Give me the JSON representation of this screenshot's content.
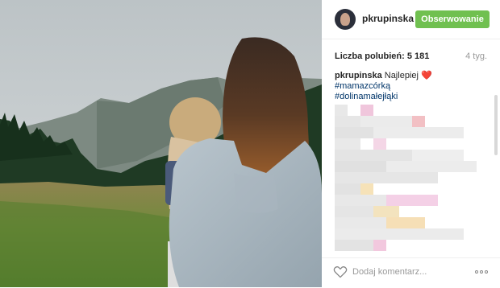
{
  "post": {
    "username": "pkrupinska",
    "follow_label": "Obserwowanie",
    "likes_label": "Liczba polubień: 5 181",
    "time_ago": "4 tyg.",
    "caption_user": "pkrupinska",
    "caption_text": "Najlepiej",
    "caption_emoji": "❤️",
    "hashtags": [
      "#mamazcórką",
      "#dolinamałejłąki"
    ],
    "comment_placeholder": "Dodaj komentarz..."
  },
  "icons": {
    "like": "heart-outline-icon",
    "more": "more-options-icon"
  },
  "colors": {
    "follow_button": "#70c050",
    "hashtag": "#003569",
    "heart": "#e0245e"
  }
}
